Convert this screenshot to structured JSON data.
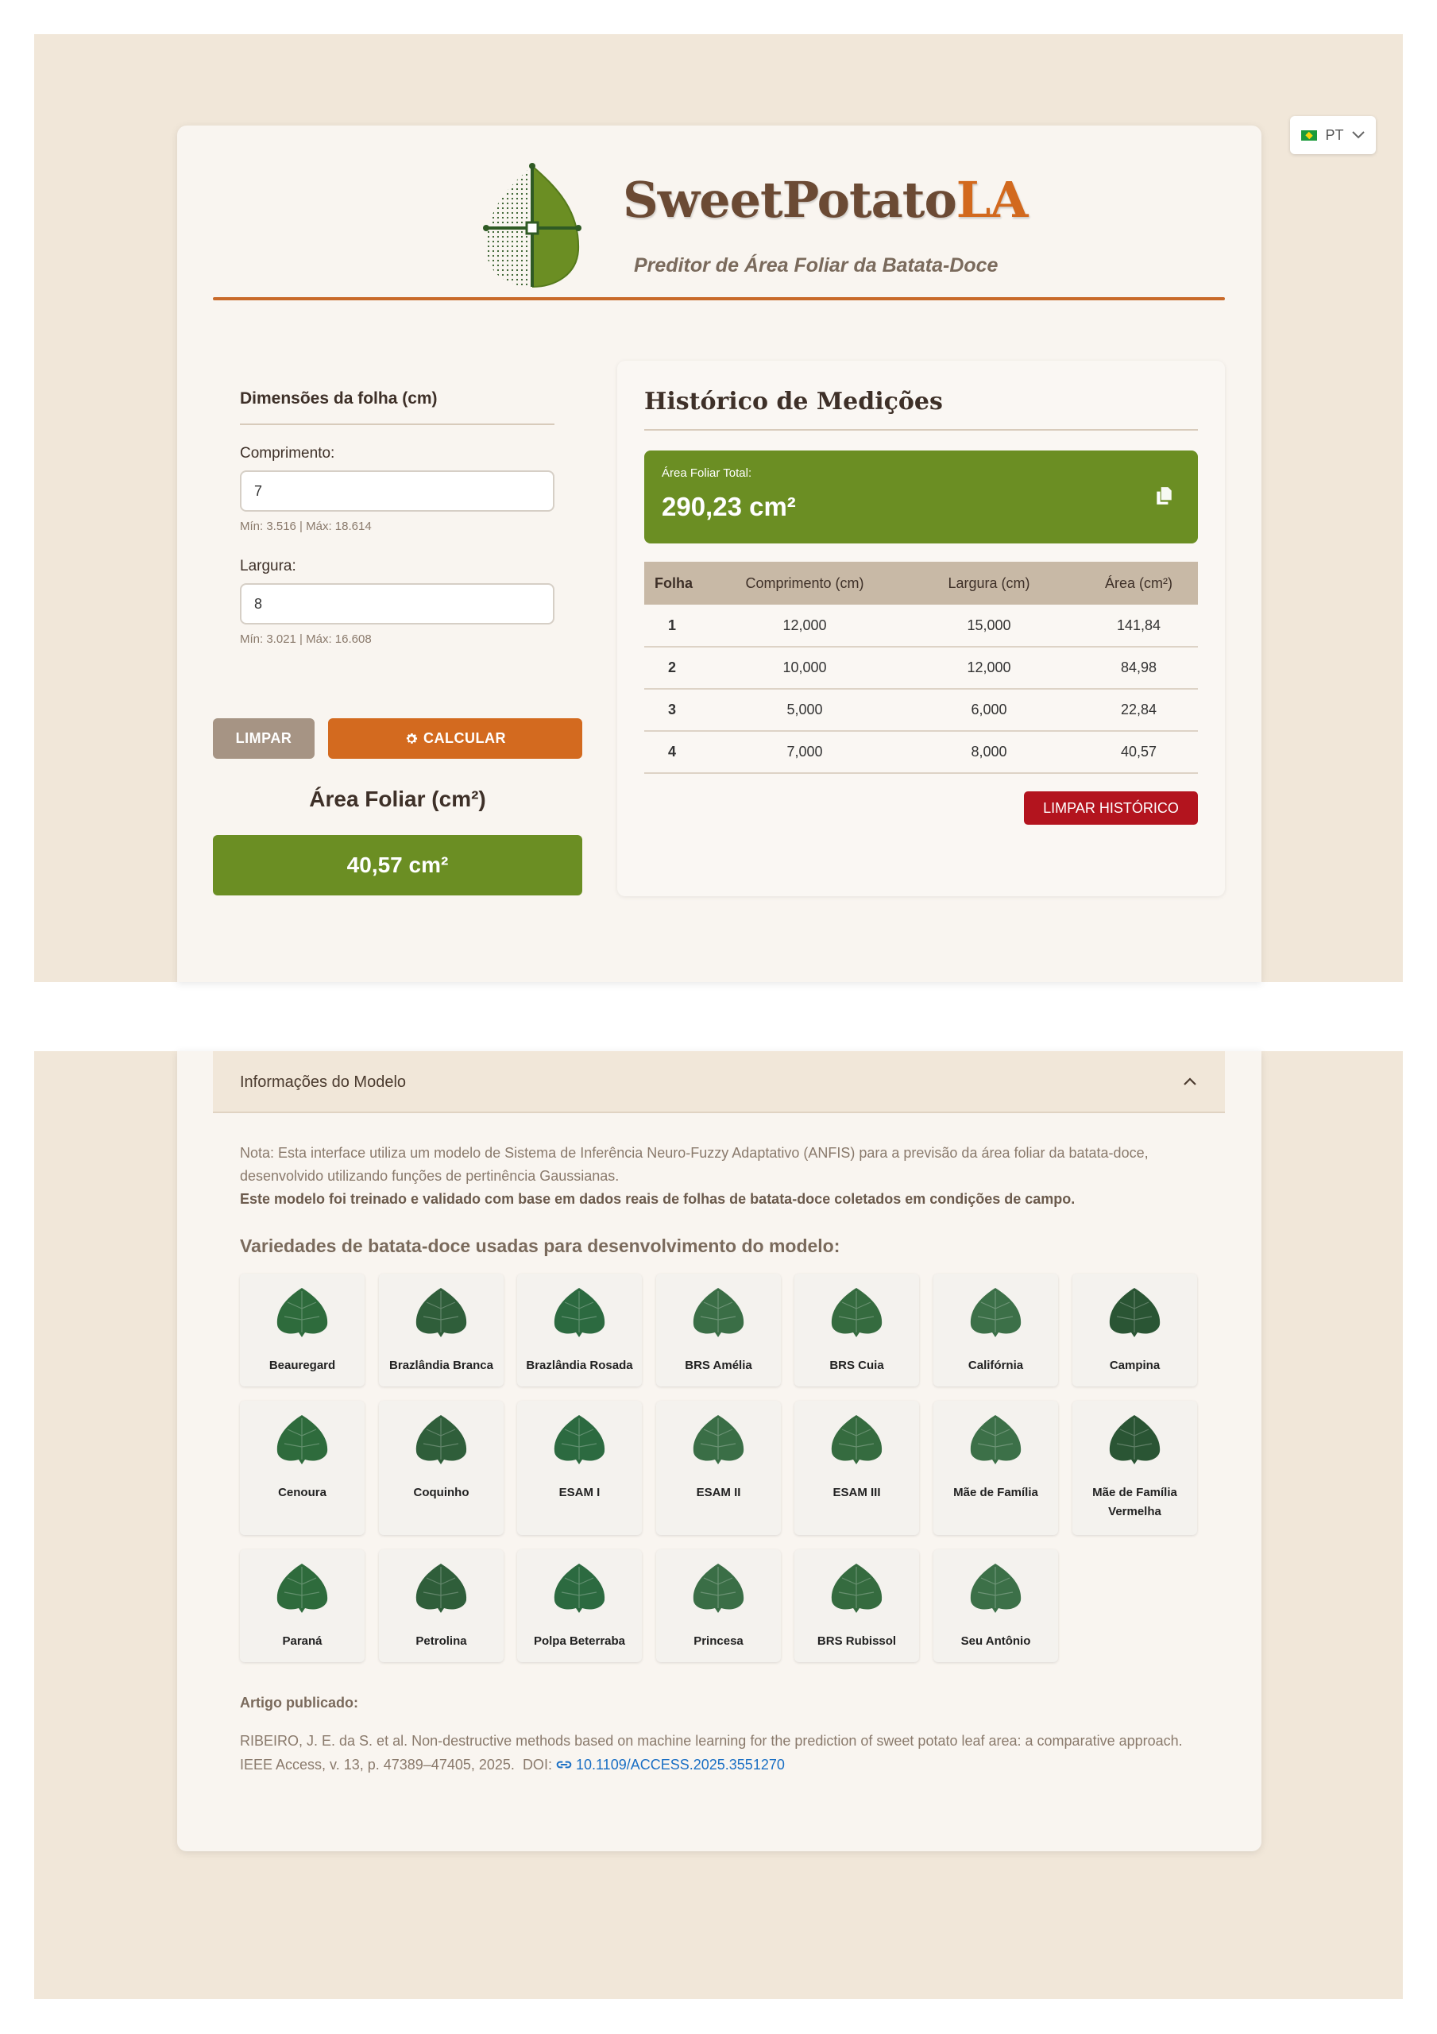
{
  "language": {
    "code": "PT"
  },
  "header": {
    "brand_main": "SweetPotato",
    "brand_accent": "LA",
    "subtitle": "Preditor de Área Foliar da Batata-Doce"
  },
  "form": {
    "title": "Dimensões da folha (cm)",
    "length_label": "Comprimento:",
    "length_value": "7",
    "length_hint": "Mín: 3.516 | Máx: 18.614",
    "width_label": "Largura:",
    "width_value": "8",
    "width_hint": "Mín: 3.021 | Máx: 16.608",
    "clear_label": "LIMPAR",
    "calc_label": "CALCULAR",
    "result_title": "Área Foliar (cm²)",
    "result_value": "40,57 cm²"
  },
  "history": {
    "title": "Histórico de Medições",
    "total_label": "Área Foliar Total:",
    "total_value": "290,23 cm²",
    "columns": [
      "Folha",
      "Comprimento (cm)",
      "Largura (cm)",
      "Área (cm²)"
    ],
    "rows": [
      [
        "1",
        "12,000",
        "15,000",
        "141,84"
      ],
      [
        "2",
        "10,000",
        "12,000",
        "84,98"
      ],
      [
        "3",
        "5,000",
        "6,000",
        "22,84"
      ],
      [
        "4",
        "7,000",
        "8,000",
        "40,57"
      ]
    ],
    "clear_label": "LIMPAR HISTÓRICO"
  },
  "model_info": {
    "title": "Informações do Modelo",
    "note": "Nota: Esta interface utiliza um modelo de Sistema de Inferência Neuro-Fuzzy Adaptativo (ANFIS) para a previsão da área foliar da batata-doce, desenvolvido utilizando funções de pertinência Gaussianas.",
    "note_bold": "Este modelo foi treinado e validado com base em dados reais de folhas de batata-doce coletados em condições de campo.",
    "varieties_title": "Variedades de batata-doce usadas para desenvolvimento do modelo:",
    "varieties": [
      "Beauregard",
      "Brazlândia Branca",
      "Brazlândia Rosada",
      "BRS Amélia",
      "BRS Cuia",
      "Califórnia",
      "Campina",
      "Cenoura",
      "Coquinho",
      "ESAM I",
      "ESAM II",
      "ESAM III",
      "Mãe de Família",
      "Mãe de Família Vermelha",
      "Paraná",
      "Petrolina",
      "Polpa Beterraba",
      "Princesa",
      "BRS Rubissol",
      "Seu Antônio"
    ],
    "article_label": "Artigo publicado:",
    "reference": "RIBEIRO, J. E. da S. et al. Non-destructive methods based on machine learning for the prediction of sweet potato leaf area: a comparative approach. IEEE Access, v. 13, p. 47389–47405, 2025.",
    "doi_prefix": "DOI:",
    "doi_link": "10.1109/ACCESS.2025.3551270"
  },
  "colors": {
    "green": "#6b8e23",
    "orange": "#d36a1f",
    "red": "#b3141e",
    "beige": "#f1e7d9",
    "link": "#1a6fc4"
  }
}
